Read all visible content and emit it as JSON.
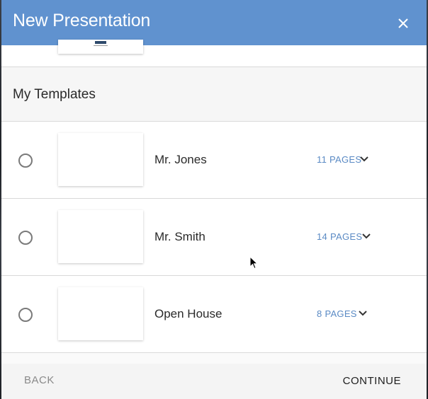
{
  "dialog": {
    "title": "New Presentation",
    "close_icon": "close-icon"
  },
  "section": {
    "label": "My Templates"
  },
  "templates": [
    {
      "name": "Mr. Jones",
      "pages": "11 PAGES",
      "selected": false
    },
    {
      "name": "Mr. Smith",
      "pages": "14 PAGES",
      "selected": false
    },
    {
      "name": "Open House",
      "pages": "8 PAGES",
      "selected": false
    }
  ],
  "footer": {
    "back_label": "BACK",
    "continue_label": "CONTINUE"
  },
  "colors": {
    "header_bg": "#6092cf",
    "pages_text": "#5a8ac4"
  }
}
